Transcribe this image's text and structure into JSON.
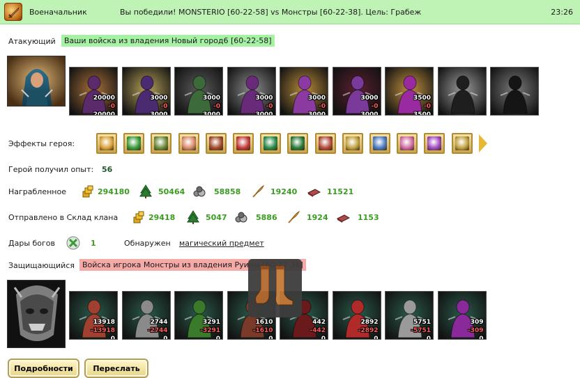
{
  "header": {
    "role": "Военачальник",
    "message": "Вы победили! MONSTERIO [60-22-58] vs Монстры [60-22-38]. Цель: Грабеж",
    "time": "23:26",
    "logo_icon": "sword-emblem-icon"
  },
  "attacker": {
    "label": "Атакующий",
    "source": "Ваши войска из владения Новый город6 [60-22-58]",
    "units": [
      {
        "icon": "ogre-unit-icon",
        "count": "20000",
        "loss": "-0",
        "remaining": "20000"
      },
      {
        "icon": "assassin-unit-icon",
        "count": "3000",
        "loss": "-0",
        "remaining": "3000"
      },
      {
        "icon": "dragon-rider-unit-icon",
        "count": "3000",
        "loss": "-0",
        "remaining": "3000"
      },
      {
        "icon": "knight-unit-icon",
        "count": "3000",
        "loss": "-0",
        "remaining": "3000"
      },
      {
        "icon": "harpy-unit-icon",
        "count": "3000",
        "loss": "-0",
        "remaining": "3000"
      },
      {
        "icon": "archer-unit-icon",
        "count": "3000",
        "loss": "-0",
        "remaining": "3000"
      },
      {
        "icon": "mage-unit-icon",
        "count": "3500",
        "loss": "-0",
        "remaining": "3500"
      },
      {
        "icon": "shadow-unit-icon",
        "count": "",
        "loss": "",
        "remaining": ""
      },
      {
        "icon": "wraith-unit-icon",
        "count": "",
        "loss": "",
        "remaining": ""
      }
    ]
  },
  "effects": {
    "label": "Эффекты героя:",
    "icons": [
      "coins-effect-icon",
      "sword-effect-icon",
      "blades-effect-icon",
      "hand-effect-icon",
      "drum-effect-icon",
      "dice-effect-icon",
      "shield-effect-icon",
      "handshake-effect-icon",
      "tent-effect-icon",
      "medal-effect-icon",
      "armor-effect-icon",
      "ring-effect-icon",
      "necklace-effect-icon",
      "staff-effect-icon"
    ]
  },
  "experience": {
    "label": "Герой получил опыт:",
    "value": "56"
  },
  "looted": {
    "label": "Награбленное",
    "items": [
      {
        "icon": "gold-icon",
        "value": "294180"
      },
      {
        "icon": "wood-icon",
        "value": "50464"
      },
      {
        "icon": "stone-icon",
        "value": "58858"
      },
      {
        "icon": "wheat-icon",
        "value": "19240"
      },
      {
        "icon": "iron-icon",
        "value": "11521"
      }
    ]
  },
  "clan_storage": {
    "label": "Отправлено в Склад клана",
    "items": [
      {
        "icon": "gold-icon",
        "value": "29418"
      },
      {
        "icon": "wood-icon",
        "value": "5047"
      },
      {
        "icon": "stone-icon",
        "value": "5886"
      },
      {
        "icon": "wheat-icon",
        "value": "1924"
      },
      {
        "icon": "iron-icon",
        "value": "1153"
      }
    ]
  },
  "gifts": {
    "label": "Дары богов",
    "value": "1",
    "found_label": "Обнаружен",
    "found_link": "магический предмет"
  },
  "defender": {
    "label": "Защищающийся",
    "source": "Войска игрока Монстры из владения Руины [60-22-38]",
    "units": [
      {
        "icon": "lizard-unit-icon",
        "count": "13918",
        "loss": "-13918",
        "remaining": "0"
      },
      {
        "icon": "golem-unit-icon",
        "count": "2744",
        "loss": "-2744",
        "remaining": "0"
      },
      {
        "icon": "orc-unit-icon",
        "count": "3291",
        "loss": "-3291",
        "remaining": "0"
      },
      {
        "icon": "beast-unit-icon",
        "count": "1610",
        "loss": "-1610",
        "remaining": "0"
      },
      {
        "icon": "spider-unit-icon",
        "count": "442",
        "loss": "-442",
        "remaining": "0"
      },
      {
        "icon": "demon-unit-icon",
        "count": "2892",
        "loss": "-2892",
        "remaining": "0"
      },
      {
        "icon": "cannon-unit-icon",
        "count": "5751",
        "loss": "-5751",
        "remaining": "0"
      },
      {
        "icon": "hydra-unit-icon",
        "count": "309",
        "loss": "-309",
        "remaining": "0"
      }
    ]
  },
  "tooltip": {
    "icon": "boots-icon"
  },
  "buttons": {
    "details": "Подробности",
    "forward": "Переслать"
  }
}
